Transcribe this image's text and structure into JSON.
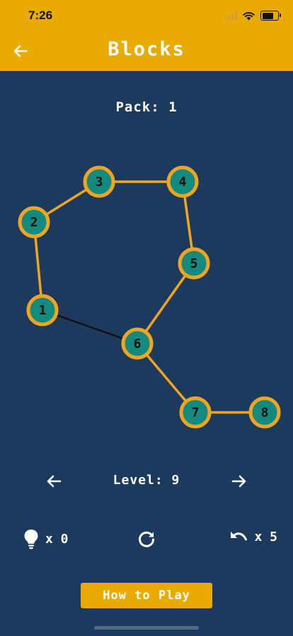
{
  "status_bar": {
    "time": "7:26",
    "battery_level": 0.8
  },
  "header": {
    "title": "Blocks",
    "back_icon": "arrow-left-icon"
  },
  "colors": {
    "header": "#eaab00",
    "background": "#1b3a5e",
    "node_fill": "#138a7f",
    "node_border": "#f1a41c",
    "edge": "#f1a41c",
    "pending_edge": "#111111"
  },
  "pack": {
    "label": "Pack:",
    "number": "1"
  },
  "puzzle": {
    "nodes": [
      {
        "id": "1",
        "label": "1"
      },
      {
        "id": "2",
        "label": "2"
      },
      {
        "id": "3",
        "label": "3"
      },
      {
        "id": "4",
        "label": "4"
      },
      {
        "id": "5",
        "label": "5"
      },
      {
        "id": "6",
        "label": "6"
      },
      {
        "id": "7",
        "label": "7"
      },
      {
        "id": "8",
        "label": "8"
      }
    ],
    "edges": [
      {
        "from": "1",
        "to": "2",
        "state": "connected"
      },
      {
        "from": "2",
        "to": "3",
        "state": "connected"
      },
      {
        "from": "3",
        "to": "4",
        "state": "connected"
      },
      {
        "from": "4",
        "to": "5",
        "state": "connected"
      },
      {
        "from": "5",
        "to": "6",
        "state": "connected"
      },
      {
        "from": "6",
        "to": "7",
        "state": "connected"
      },
      {
        "from": "7",
        "to": "8",
        "state": "connected"
      },
      {
        "from": "1",
        "to": "6",
        "state": "pending"
      }
    ]
  },
  "level": {
    "label": "Level:",
    "number": "9",
    "prev_icon": "arrow-left-icon",
    "next_icon": "arrow-right-icon"
  },
  "tools": {
    "hints": {
      "icon": "lightbulb-icon",
      "text": "x 0"
    },
    "restart": {
      "icon": "restart-icon"
    },
    "undo": {
      "icon": "undo-icon",
      "text": "x 5"
    }
  },
  "how_to_play": {
    "label": "How to Play"
  }
}
